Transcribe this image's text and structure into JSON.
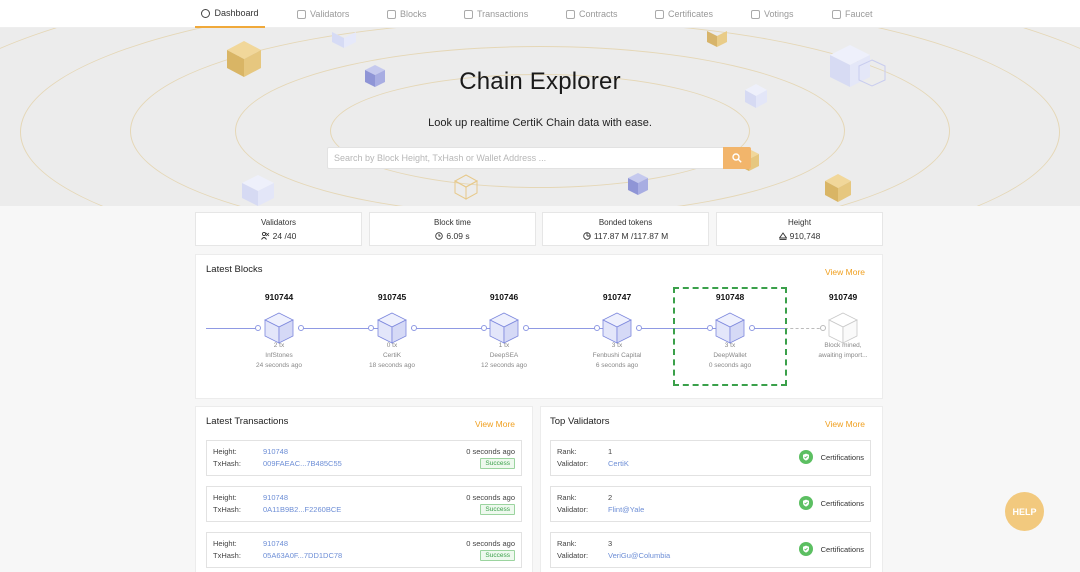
{
  "nav": {
    "items": [
      {
        "label": "Dashboard",
        "icon": "dashboard-icon",
        "active": true
      },
      {
        "label": "Validators",
        "icon": "validators-icon"
      },
      {
        "label": "Blocks",
        "icon": "blocks-icon"
      },
      {
        "label": "Transactions",
        "icon": "transactions-icon"
      },
      {
        "label": "Contracts",
        "icon": "contracts-icon"
      },
      {
        "label": "Certificates",
        "icon": "certificates-icon"
      },
      {
        "label": "Votings",
        "icon": "votings-icon"
      },
      {
        "label": "Faucet",
        "icon": "faucet-icon"
      }
    ]
  },
  "hero": {
    "title": "Chain Explorer",
    "subtitle": "Look up realtime CertiK Chain data with ease.",
    "search_placeholder": "Search by Block Height, TxHash or Wallet Address ..."
  },
  "stats": [
    {
      "label": "Validators",
      "value": "24 /40",
      "icon": "validators-icon"
    },
    {
      "label": "Block time",
      "value": "6.09 s",
      "icon": "clock-icon"
    },
    {
      "label": "Bonded tokens",
      "value": "117.87 M /117.87 M",
      "icon": "pie-icon"
    },
    {
      "label": "Height",
      "value": "910,748",
      "icon": "height-icon"
    }
  ],
  "latest_blocks": {
    "title": "Latest Blocks",
    "view_more": "View More",
    "blocks": [
      {
        "height": "910744",
        "tx": "2 tx",
        "miner": "InfStones",
        "ago": "24 seconds ago"
      },
      {
        "height": "910745",
        "tx": "0 tx",
        "miner": "CertiK",
        "ago": "18 seconds ago"
      },
      {
        "height": "910746",
        "tx": "1 tx",
        "miner": "DeepSEA",
        "ago": "12 seconds ago"
      },
      {
        "height": "910747",
        "tx": "3 tx",
        "miner": "Fenbushi Capital",
        "ago": "6 seconds ago"
      },
      {
        "height": "910748",
        "tx": "3 tx",
        "miner": "DeepWallet",
        "ago": "0 seconds ago"
      },
      {
        "height": "910749",
        "pending_line1": "Block mined,",
        "pending_line2": "awaiting import..."
      }
    ]
  },
  "latest_transactions": {
    "title": "Latest Transactions",
    "view_more": "View More",
    "height_label": "Height:",
    "hash_label": "TxHash:",
    "rows": [
      {
        "height": "910748",
        "hash": "009FAEAC...7B485C55",
        "ago": "0 seconds ago",
        "status": "Success"
      },
      {
        "height": "910748",
        "hash": "0A11B9B2...F2260BCE",
        "ago": "0 seconds ago",
        "status": "Success"
      },
      {
        "height": "910748",
        "hash": "05A63A0F...7DD1DC78",
        "ago": "0 seconds ago",
        "status": "Success"
      }
    ]
  },
  "top_validators": {
    "title": "Top Validators",
    "view_more": "View More",
    "rank_label": "Rank:",
    "validator_label": "Validator:",
    "rows": [
      {
        "rank": "1",
        "validator": "CertiK",
        "cert": "Certifications"
      },
      {
        "rank": "2",
        "validator": "Flint@Yale",
        "cert": "Certifications"
      },
      {
        "rank": "3",
        "validator": "VeriGu@Columbia",
        "cert": "Certifications"
      }
    ]
  },
  "help": "HELP",
  "colors": {
    "accent": "#f0a020",
    "link": "#6d8ed6",
    "success": "#3aa04a",
    "chain": "#8f99e3",
    "highlight": "#3aa04a"
  }
}
